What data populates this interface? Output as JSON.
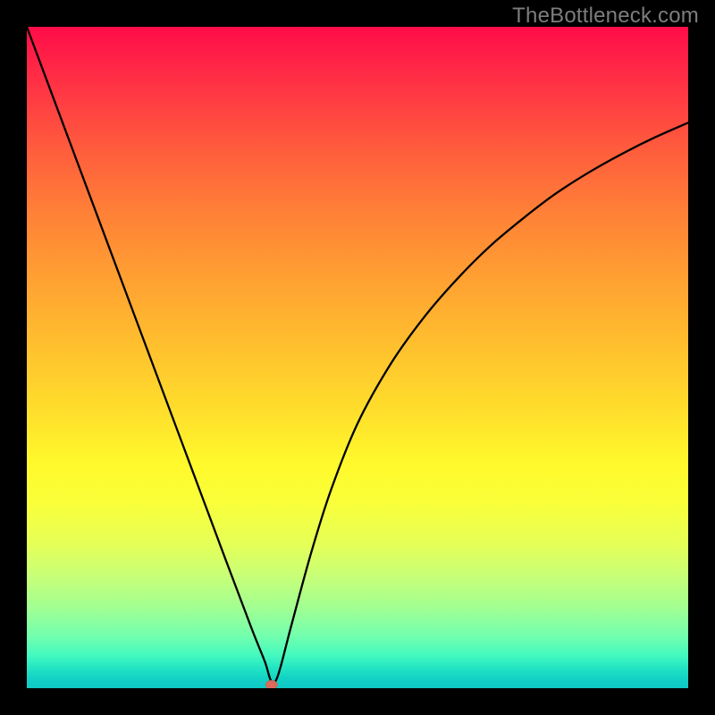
{
  "watermark": "TheBottleneck.com",
  "colors": {
    "page_bg": "#000000",
    "watermark": "#7d7d7d",
    "curve_stroke": "#000000",
    "marker_fill": "#db6a5c",
    "marker_stroke": "#c65a4d",
    "gradient_top": "#ff0c49",
    "gradient_bottom": "#0fc9c6"
  },
  "chart_data": {
    "type": "line",
    "title": "",
    "xlabel": "",
    "ylabel": "",
    "x": [
      0.0,
      0.05,
      0.1,
      0.15,
      0.2,
      0.25,
      0.3,
      0.34,
      0.36,
      0.37,
      0.38,
      0.4,
      0.43,
      0.46,
      0.5,
      0.55,
      0.6,
      0.65,
      0.7,
      0.75,
      0.8,
      0.85,
      0.9,
      0.95,
      1.0
    ],
    "values": [
      1.0,
      0.866,
      0.732,
      0.598,
      0.464,
      0.33,
      0.196,
      0.09,
      0.04,
      0.01,
      0.02,
      0.095,
      0.205,
      0.3,
      0.4,
      0.49,
      0.56,
      0.618,
      0.668,
      0.71,
      0.748,
      0.78,
      0.808,
      0.833,
      0.855
    ],
    "xlim": [
      0,
      1
    ],
    "ylim": [
      0,
      1
    ],
    "marker": {
      "x": 0.37,
      "y": 0.005
    }
  }
}
